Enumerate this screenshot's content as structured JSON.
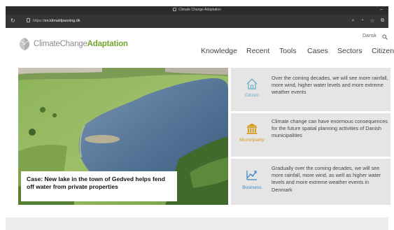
{
  "browser": {
    "window_title": "Climate Change Adaptation",
    "url_scheme": "https://",
    "url_host": "en.klimatilpasning.dk",
    "minimize_glyph": "–"
  },
  "header": {
    "logo_text_main": "ClimateChange",
    "logo_text_accent": "Adaptation",
    "language": "Dansk"
  },
  "nav": {
    "items": [
      "Knowledge",
      "Recent",
      "Tools",
      "Cases",
      "Sectors",
      "Citizen"
    ]
  },
  "hero": {
    "caption": "Case: New lake in the town of Gedved helps fend off water from private properties"
  },
  "targets": [
    {
      "label": "Citizen",
      "icon": "house-icon",
      "text": "Over the coming decades, we will see more rainfall, more wind, higher water levels and more extreme weather events"
    },
    {
      "label": "Municipality",
      "icon": "town-hall-icon",
      "text": "Climate change can have enormous consequences for the future spatial planning activities of Danish municipalities"
    },
    {
      "label": "Business",
      "icon": "business-chart-icon",
      "text": "Gradually over the coming decades, we will see more rainfall, more wind, as well as higher water levels and more extreme weather events in Denmark"
    }
  ],
  "colors": {
    "citizen": "#6aaec8",
    "municipality": "#d49a1e",
    "business": "#3f86c6",
    "logo_accent": "#6fa62f",
    "panel_bg": "#e5e5e5"
  }
}
